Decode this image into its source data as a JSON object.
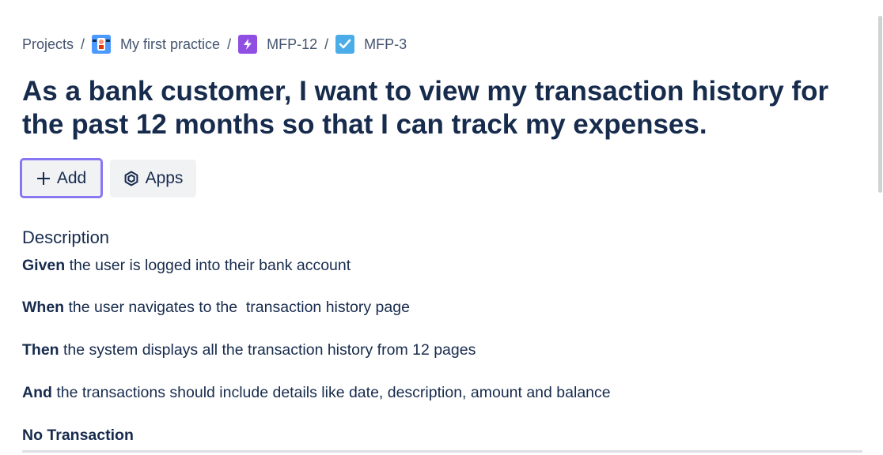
{
  "breadcrumb": {
    "projects": "Projects",
    "separator": "/",
    "project": "My first practice",
    "epic": "MFP-12",
    "issue": "MFP-3"
  },
  "issue": {
    "title": "As a bank customer, I want to view my transaction history for the past 12 months so that I can track my expenses."
  },
  "actions": {
    "add_label": "Add",
    "apps_label": "Apps"
  },
  "description": {
    "heading": "Description",
    "lines": [
      {
        "keyword": "Given",
        "text": " the user is logged into their bank account"
      },
      {
        "keyword": "When",
        "text": " the user navigates to the  transaction history page"
      },
      {
        "keyword": "Then",
        "text": " the system displays all the transaction history from 12 pages"
      },
      {
        "keyword": "And",
        "text": " the transactions should include details like date, description, amount and balance"
      }
    ],
    "subheading": "No Transaction"
  },
  "colors": {
    "text": "#172b4d",
    "subtle_text": "#44546f",
    "button_bg": "#f1f2f4",
    "focus_ring": "#8777f2",
    "epic_icon": "#904ee2",
    "story_icon": "#4bade8",
    "project_icon": "#4c9aff"
  },
  "icons": {
    "project": "project-avatar-icon",
    "epic": "lightning-icon",
    "issue": "checkbox-icon",
    "add": "plus-icon",
    "apps": "hexagon-icon"
  }
}
